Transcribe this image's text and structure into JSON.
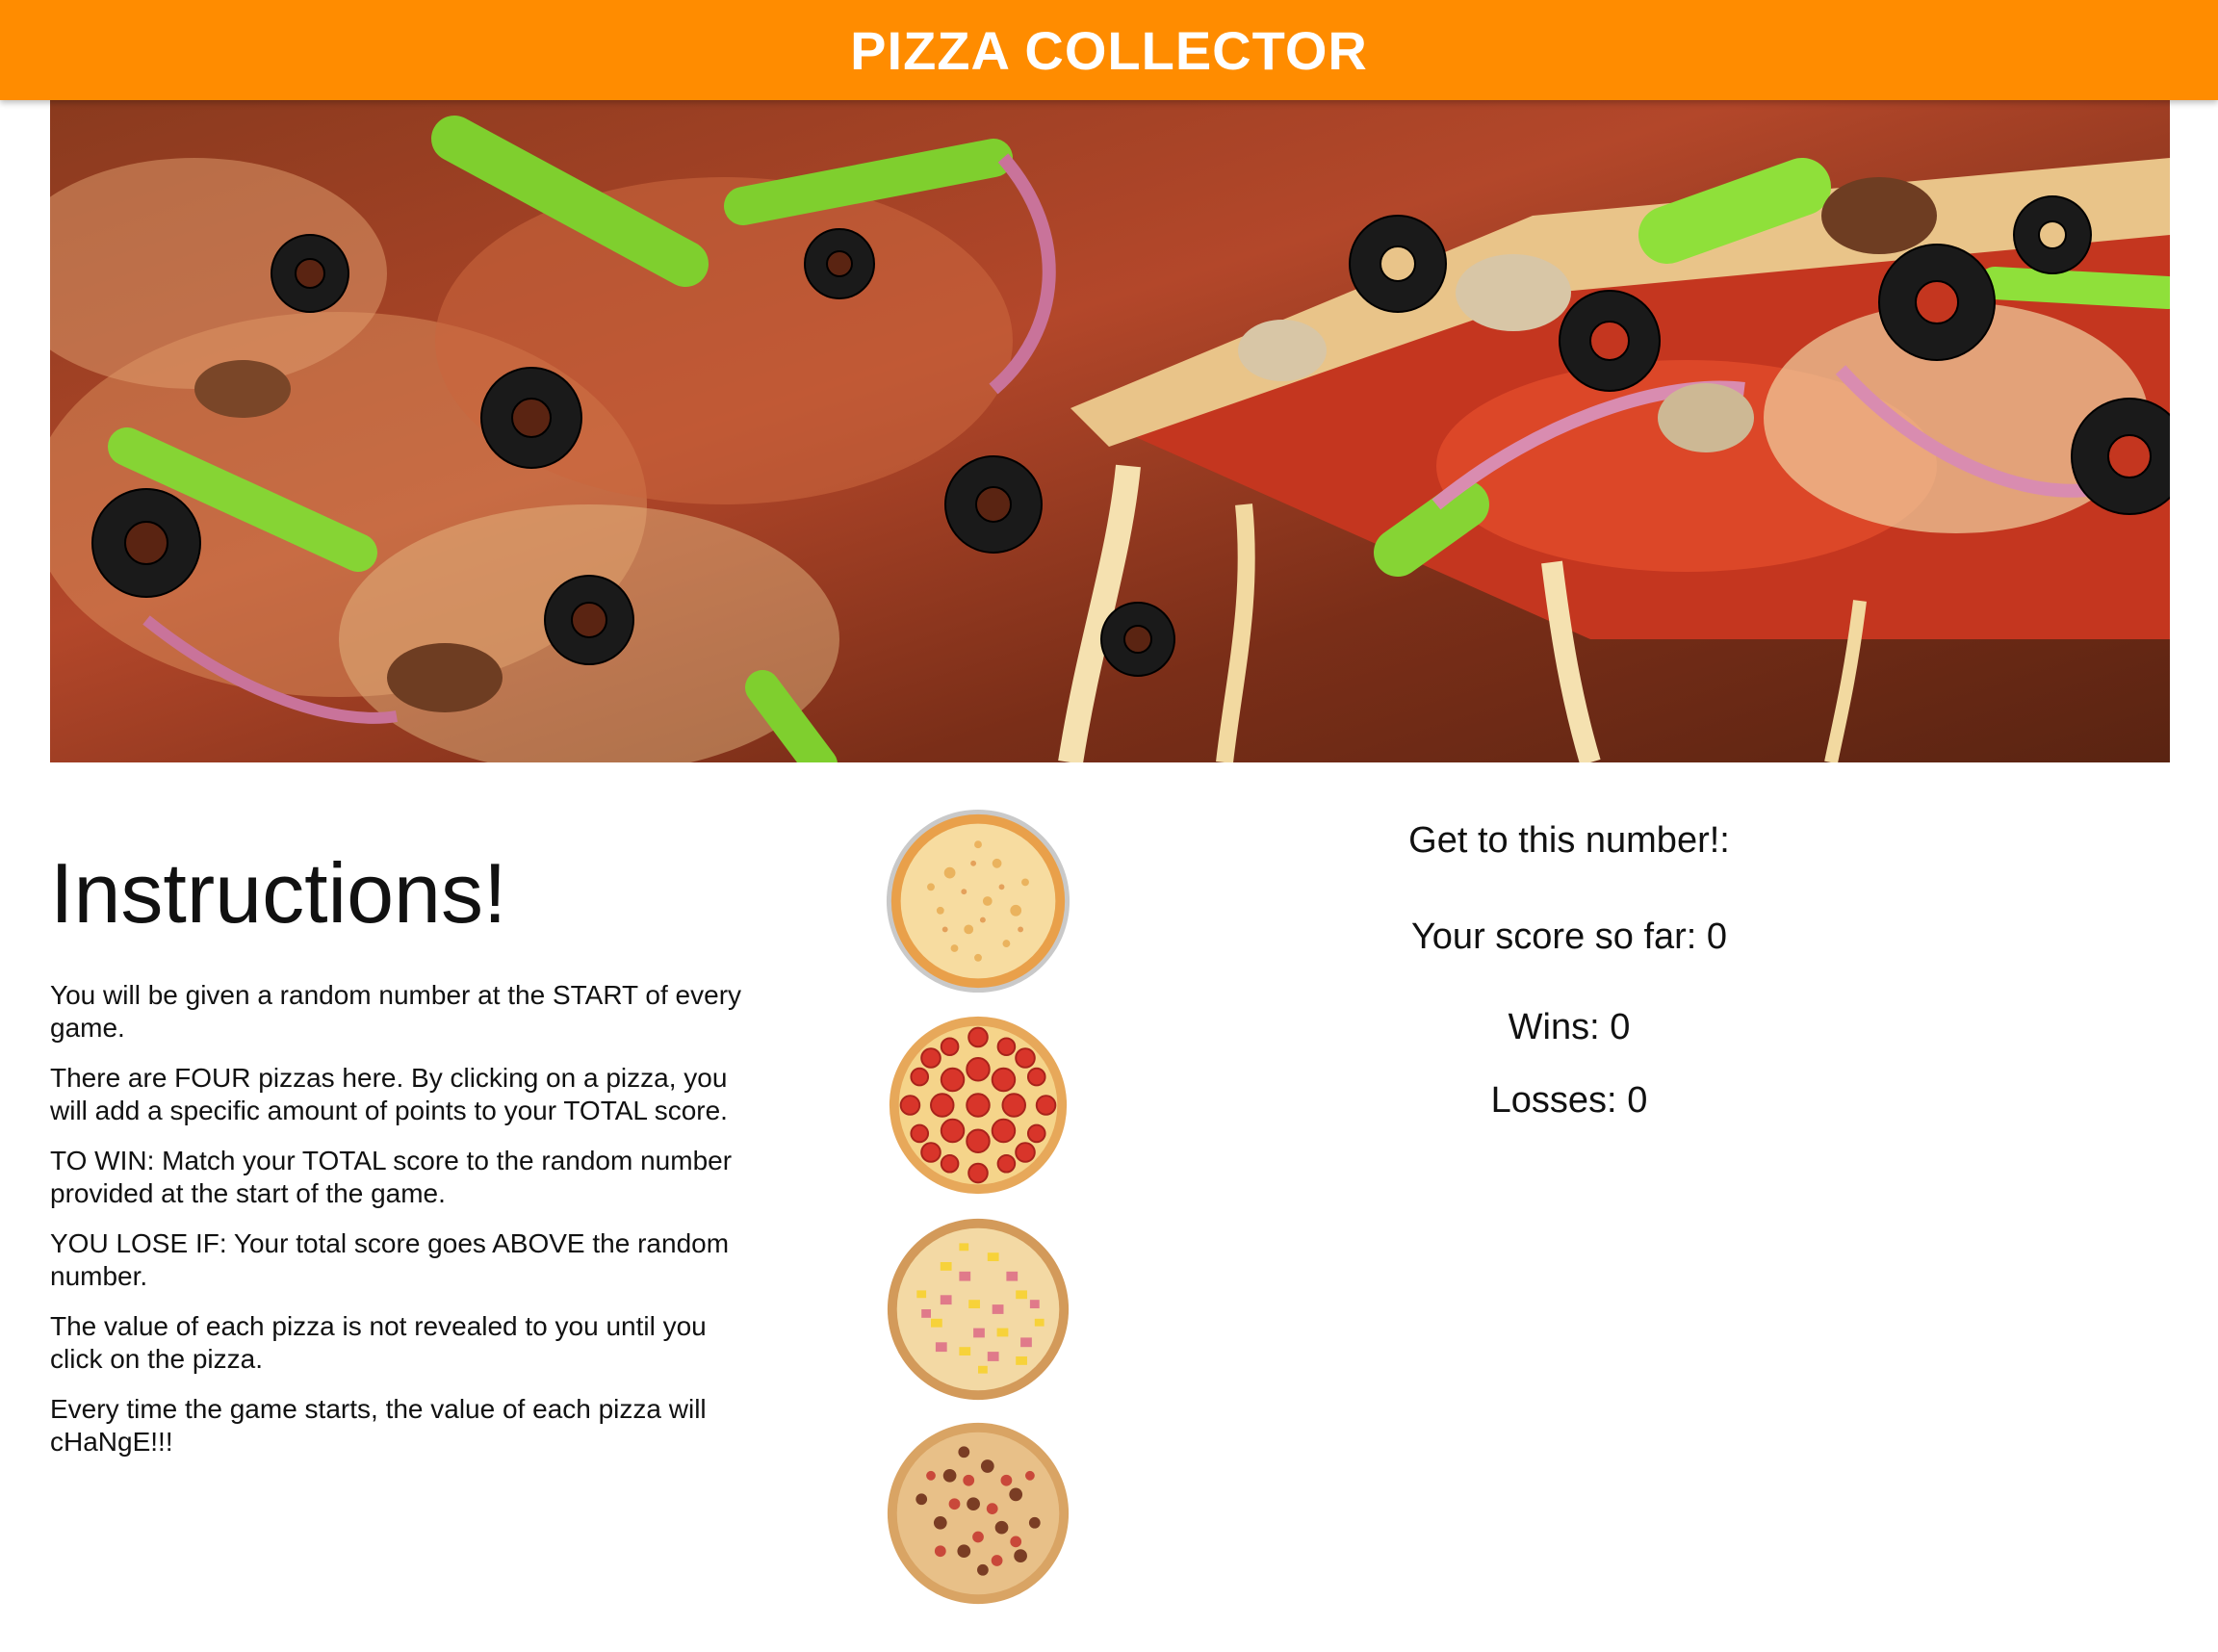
{
  "header": {
    "title": "PIZZA COLLECTOR",
    "bg_color": "#ff8c00"
  },
  "instructions": {
    "heading": "Instructions!",
    "paragraphs": [
      "You will be given a random number at the START of every game.",
      "There are FOUR pizzas here. By clicking on a pizza, you will add a specific amount of points to your TOTAL score.",
      "TO WIN: Match your TOTAL score to the random number provided at the start of the game.",
      "YOU LOSE IF: Your total score goes ABOVE the random number.",
      "The value of each pizza is not revealed to you until you click on the pizza.",
      "Every time the game starts, the value of each pizza will cHaNgE!!!"
    ]
  },
  "pizzas": [
    {
      "icon": "cheese-pizza-icon"
    },
    {
      "icon": "pepperoni-pizza-icon"
    },
    {
      "icon": "hawaiian-pizza-icon"
    },
    {
      "icon": "meat-pizza-icon"
    }
  ],
  "scoreboard": {
    "target_label": "Get to this number!:",
    "score_label": "Your score so far:",
    "score_value": "0",
    "wins_label": "Wins:",
    "wins_value": "0",
    "losses_label": "Losses:",
    "losses_value": "0"
  }
}
